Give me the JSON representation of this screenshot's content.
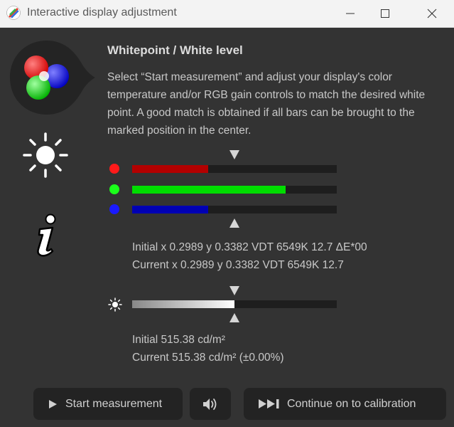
{
  "window": {
    "title": "Interactive display adjustment",
    "icons": {
      "app": "rgb-spheres-app-icon",
      "minimize": "minimize-icon",
      "maximize": "maximize-icon",
      "close": "close-icon"
    }
  },
  "sidebar": {
    "icons": [
      "rgb-color-spheres-icon",
      "brightness-sun-icon",
      "info-icon"
    ]
  },
  "main": {
    "heading": "Whitepoint / White level",
    "description": "Select “Start measurement” and adjust your display's color temperature and/or RGB gain controls to match the desired white point. A good match is obtained if all bars can be brought to the marked position in the center.",
    "rgb_bars": [
      {
        "channel": "red",
        "color": "#b30000",
        "dot_color": "#ff1a1a",
        "level": 0.37
      },
      {
        "channel": "green",
        "color": "#00dd00",
        "dot_color": "#1aff1a",
        "level": 0.75
      },
      {
        "channel": "blue",
        "color": "#0000b3",
        "dot_color": "#1a1aff",
        "level": 0.37
      }
    ],
    "whitepoint_initial": "Initial x 0.2989 y 0.3382 VDT 6549K 12.7 ΔE*00",
    "whitepoint_current": "Current x 0.2989 y 0.3382 VDT 6549K 12.7",
    "luminance_bar": {
      "level": 0.5
    },
    "luminance_initial": "Initial 515.38 cd/m²",
    "luminance_current": "Current 515.38 cd/m² (±0.00%)"
  },
  "buttons": {
    "start": "Start measurement",
    "sound_icon": "speaker-icon",
    "continue": "Continue on to calibration"
  },
  "colors": {
    "background": "#333333",
    "titlebar": "#f3f3f3",
    "button": "#232323"
  }
}
